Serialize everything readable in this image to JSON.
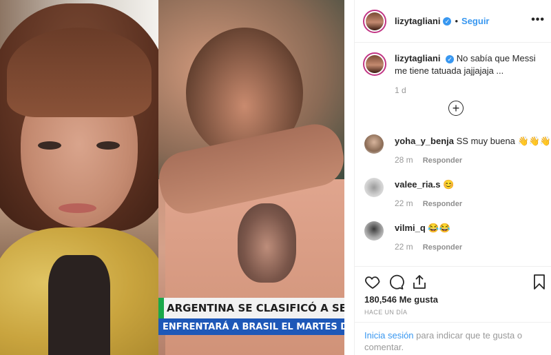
{
  "post": {
    "username": "lizytagliani",
    "follow_label": "Seguir",
    "dot": "•",
    "more": "•••",
    "caption": "No sabía que Messi me tiene tatuada jajjajaja ...",
    "caption_time": "1 d",
    "load_more": "+",
    "likes": "180,546 Me gusta",
    "posted_ago": "HACE UN DÍA",
    "login_link": "Inicia sesión",
    "login_text": " para indicar que te gusta o comentar."
  },
  "media": {
    "tv_headline": "ARGENTINA SE CLASIFICÓ A SEMIFI",
    "tv_subheadline": "ENFRENTARÁ A BRASIL EL MARTES DESDE LAS"
  },
  "comments": [
    {
      "user": "yoha_y_benja",
      "text": "SS muy buena 👋👋👋",
      "time": "28 m",
      "reply": "Responder"
    },
    {
      "user": "valee_ria.s",
      "text": "😊",
      "time": "22 m",
      "reply": "Responder"
    },
    {
      "user": "vilmi_q",
      "text": "😂😂",
      "time": "22 m",
      "reply": "Responder"
    }
  ],
  "icons": {
    "verified": "verified-badge-icon",
    "heart": "heart-icon",
    "comment": "comment-icon",
    "share": "share-icon",
    "save": "bookmark-icon",
    "add": "plus-circle-icon"
  },
  "colors": {
    "link": "#3897f0",
    "ring": "#c13584",
    "muted": "#999999",
    "tv_green": "#19a84a",
    "tv_blue": "#1e58b8"
  }
}
